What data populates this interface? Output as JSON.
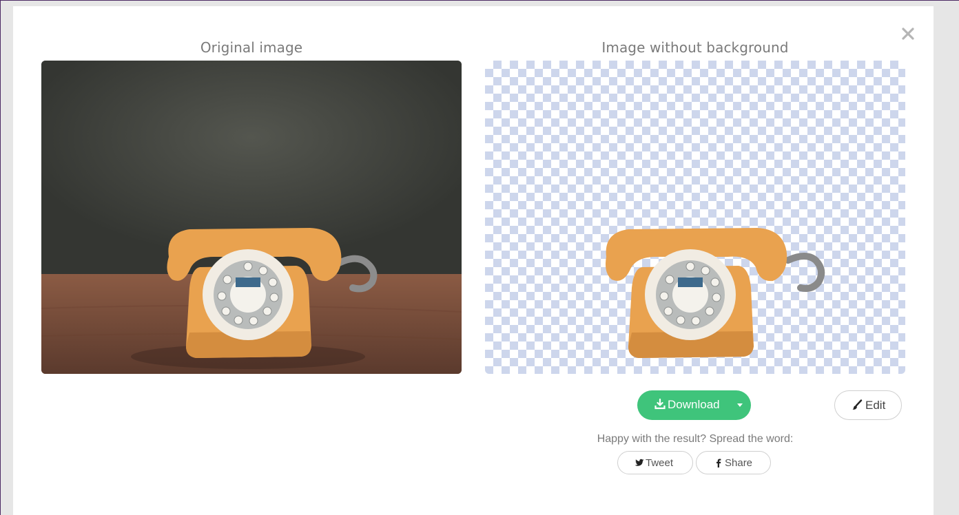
{
  "modal": {
    "original_title": "Original image",
    "result_title": "Image without background",
    "download_label": "Download",
    "edit_label": "Edit",
    "spread_text": "Happy with the result? Spread the word:",
    "tweet_label": "Tweet",
    "share_label": "Share"
  },
  "icons": {
    "close": "close-icon",
    "download": "download-icon",
    "caret": "chevron-down-icon",
    "edit": "brush-icon",
    "twitter": "twitter-icon",
    "facebook": "facebook-icon"
  },
  "colors": {
    "download_button": "#3fc47b",
    "checker": "#cdd6ec",
    "phone_body": "#e9a24f"
  }
}
